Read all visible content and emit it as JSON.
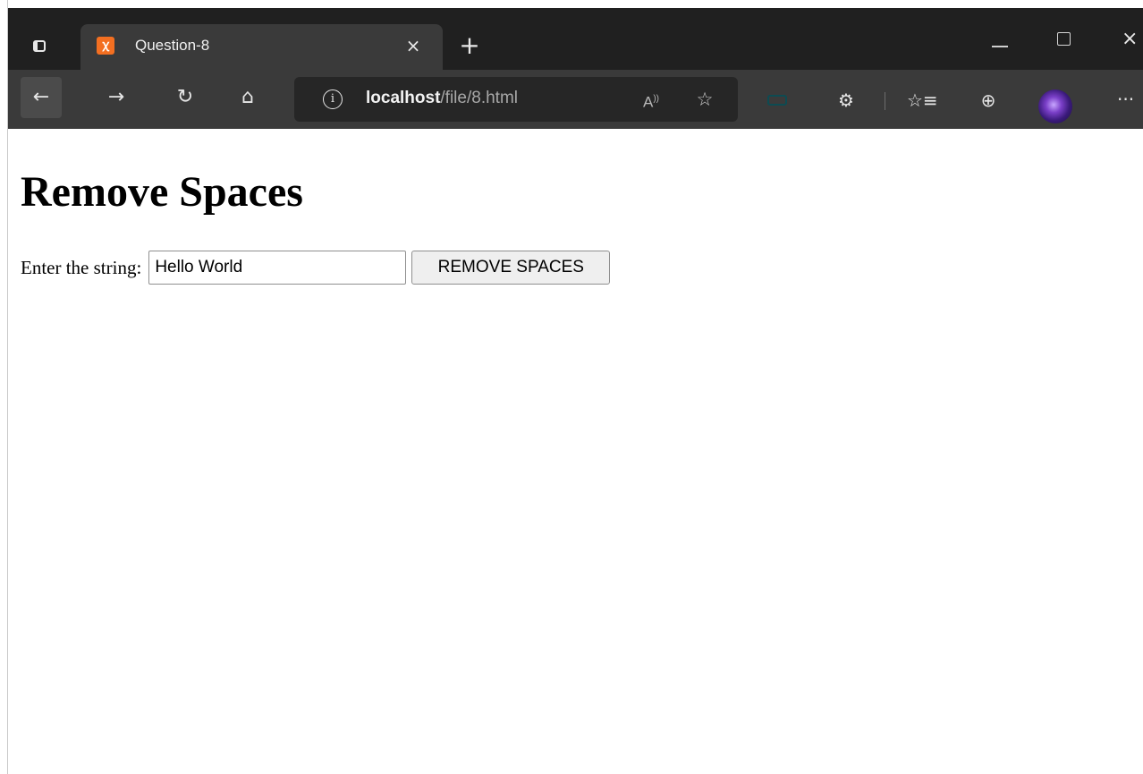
{
  "browser": {
    "tab": {
      "title": "Question-8",
      "favicon": "xampp-icon",
      "close": "×"
    },
    "new_tab": "+",
    "window_controls": {
      "minimize": "minimize-icon",
      "maximize": "maximize-icon",
      "close": "×"
    },
    "toolbar": {
      "back": "←",
      "forward": "→",
      "reload": "↻",
      "home": "⌂",
      "read_aloud": "A⁾",
      "favorites_add": "☆",
      "extensions": "⚙",
      "favorites": "☆≡",
      "collections": "⊕",
      "more": "···"
    },
    "address_bar": {
      "host": "localhost",
      "path": "/file/8.html",
      "info": "i"
    }
  },
  "page": {
    "heading": "Remove Spaces",
    "label": "Enter the string:",
    "input_value": "Hello World",
    "button_label": "REMOVE SPACES"
  },
  "colors": {
    "tabstrip_bg": "#202020",
    "toolbar_bg": "#3a3a3a",
    "favicon": "#f36f21"
  }
}
